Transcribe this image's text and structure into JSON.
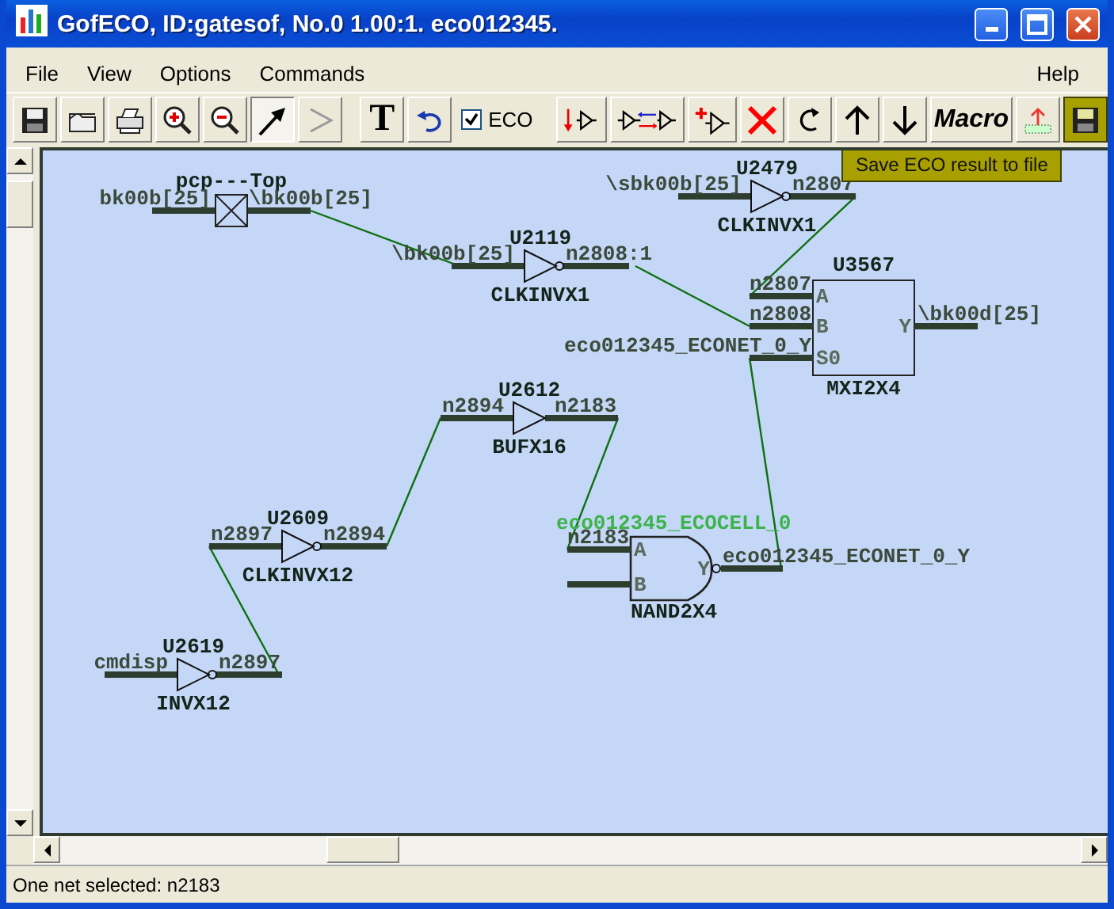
{
  "window": {
    "title": "GofECO, ID:gatesof, No.0 1.00:1. eco012345."
  },
  "menu": [
    {
      "label": "File"
    },
    {
      "label": "View"
    },
    {
      "label": "Options"
    },
    {
      "label": "Commands"
    },
    {
      "label": "Help"
    }
  ],
  "toolbar": {
    "buttons": [
      {
        "kind": "save",
        "pressed": false,
        "hovered": false
      },
      {
        "kind": "open",
        "pressed": false,
        "hovered": false
      },
      {
        "kind": "print",
        "pressed": false,
        "hovered": false
      },
      {
        "kind": "zoom-in",
        "pressed": false,
        "hovered": false
      },
      {
        "kind": "zoom-out",
        "pressed": false,
        "hovered": false
      },
      {
        "kind": "select",
        "pressed": true,
        "hovered": false
      },
      {
        "kind": "wire",
        "pressed": false,
        "hovered": false
      },
      {
        "kind": "text",
        "label": "T",
        "pressed": false,
        "hovered": false
      },
      {
        "kind": "undo",
        "pressed": false,
        "hovered": false
      },
      {
        "kind": "checkbox",
        "label": "ECO",
        "checked": true
      },
      {
        "kind": "remove-gate",
        "pressed": false,
        "hovered": false
      },
      {
        "kind": "swap-gates",
        "pressed": false,
        "hovered": false
      },
      {
        "kind": "insert-gate",
        "pressed": false,
        "hovered": false
      },
      {
        "kind": "delete",
        "pressed": false,
        "hovered": false
      },
      {
        "kind": "redo",
        "pressed": false,
        "hovered": false
      },
      {
        "kind": "up",
        "pressed": false,
        "hovered": false
      },
      {
        "kind": "down",
        "pressed": false,
        "hovered": false
      },
      {
        "kind": "macro",
        "label": "Macro",
        "pressed": false,
        "hovered": false
      },
      {
        "kind": "export",
        "pressed": false,
        "hovered": false
      },
      {
        "kind": "save-eco",
        "pressed": false,
        "hovered": true
      }
    ]
  },
  "tooltip": "Save ECO result to file",
  "schematic": {
    "cells": [
      {
        "kind": "port",
        "instance": "pcp---Top",
        "eco": false,
        "inputs": [
          {
            "net": "bk00b[25]"
          }
        ],
        "outputs": [
          {
            "net": "\\bk00b[25]"
          }
        ]
      },
      {
        "kind": "inverter",
        "instance": "U2119",
        "type": "CLKINVX1",
        "eco": false,
        "inputs": [
          {
            "net": "\\bk00b[25]"
          }
        ],
        "outputs": [
          {
            "net": "n2808:1"
          }
        ]
      },
      {
        "kind": "inverter",
        "instance": "U2479",
        "type": "CLKINVX1",
        "eco": false,
        "inputs": [
          {
            "net": "\\sbk00b[25]"
          }
        ],
        "outputs": [
          {
            "net": "n2807"
          }
        ]
      },
      {
        "kind": "mux",
        "instance": "U3567",
        "type": "MXI2X4",
        "eco": false,
        "inputs": [
          {
            "pin": "A",
            "net": "n2807"
          },
          {
            "pin": "B",
            "net": "n2808"
          },
          {
            "pin": "S0",
            "net": "eco012345_ECONET_0_Y"
          }
        ],
        "outputs": [
          {
            "pin": "Y",
            "net": "\\bk00d[25]"
          }
        ]
      },
      {
        "kind": "buffer",
        "instance": "U2612",
        "type": "BUFX16",
        "eco": false,
        "inputs": [
          {
            "net": "n2894"
          }
        ],
        "outputs": [
          {
            "net": "n2183"
          }
        ]
      },
      {
        "kind": "inverter",
        "instance": "U2609",
        "type": "CLKINVX12",
        "eco": false,
        "inputs": [
          {
            "net": "n2897"
          }
        ],
        "outputs": [
          {
            "net": "n2894"
          }
        ]
      },
      {
        "kind": "inverter",
        "instance": "U2619",
        "type": "INVX12",
        "eco": false,
        "inputs": [
          {
            "net": "cmdisp"
          }
        ],
        "outputs": [
          {
            "net": "n2897"
          }
        ]
      },
      {
        "kind": "nand",
        "instance": "eco012345_ECOCELL_0",
        "type": "NAND2X4",
        "eco": true,
        "inputs": [
          {
            "pin": "A",
            "net": "n2183"
          },
          {
            "pin": "B"
          }
        ],
        "outputs": [
          {
            "pin": "Y",
            "net": "eco012345_ECONET_0_Y"
          }
        ]
      }
    ]
  },
  "status_bar": "One net selected: n2183"
}
